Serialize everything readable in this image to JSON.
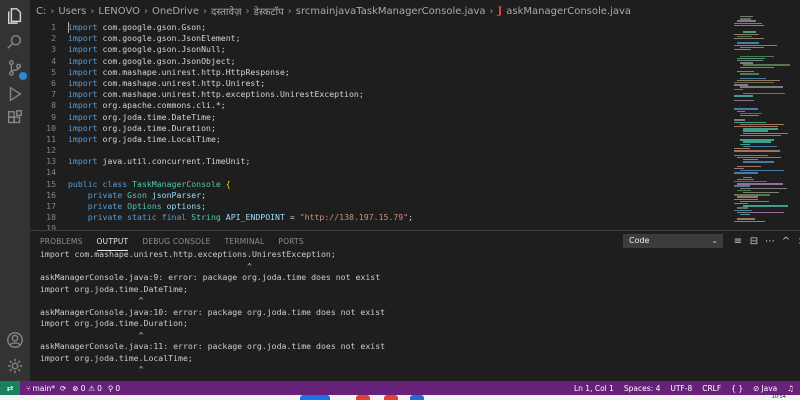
{
  "breadcrumb": {
    "segments": [
      "C:",
      "Users",
      "LENOVO",
      "OneDrive",
      "दस्तावेज़",
      "डेस्कटॉप",
      "srcmainjavaTaskManagerConsole.java"
    ],
    "file_icon": "J",
    "file": "askManagerConsole.java"
  },
  "activity_bar": [
    "files-icon",
    "search-icon",
    "source-control-icon",
    "run-debug-icon",
    "extensions-icon",
    "account-icon",
    "settings-gear-icon"
  ],
  "editor": {
    "lines": [
      {
        "n": "1",
        "tokens": [
          [
            "kw",
            "import"
          ],
          [
            "pl",
            " com.google.gson.Gson;"
          ]
        ]
      },
      {
        "n": "2",
        "tokens": [
          [
            "kw",
            "import"
          ],
          [
            "pl",
            " com.google.gson.JsonElement;"
          ]
        ]
      },
      {
        "n": "3",
        "tokens": [
          [
            "kw",
            "import"
          ],
          [
            "pl",
            " com.google.gson.JsonNull;"
          ]
        ]
      },
      {
        "n": "4",
        "tokens": [
          [
            "kw",
            "import"
          ],
          [
            "pl",
            " com.google.gson.JsonObject;"
          ]
        ]
      },
      {
        "n": "5",
        "tokens": [
          [
            "kw",
            "import"
          ],
          [
            "pl",
            " com.mashape.unirest.http.HttpResponse;"
          ]
        ]
      },
      {
        "n": "6",
        "tokens": [
          [
            "kw",
            "import"
          ],
          [
            "pl",
            " com.mashape.unirest.http.Unirest;"
          ]
        ]
      },
      {
        "n": "7",
        "tokens": [
          [
            "kw",
            "import"
          ],
          [
            "pl",
            " com.mashape.unirest.http.exceptions.UnirestException;"
          ]
        ]
      },
      {
        "n": "8",
        "tokens": [
          [
            "kw",
            "import"
          ],
          [
            "pl",
            " org.apache.commons.cli.*;"
          ]
        ]
      },
      {
        "n": "9",
        "tokens": [
          [
            "kw",
            "import"
          ],
          [
            "pl",
            " org.joda.time.DateTime;"
          ]
        ]
      },
      {
        "n": "10",
        "tokens": [
          [
            "kw",
            "import"
          ],
          [
            "pl",
            " org.joda.time.Duration;"
          ]
        ]
      },
      {
        "n": "11",
        "tokens": [
          [
            "kw",
            "import"
          ],
          [
            "pl",
            " org.joda.time.LocalTime;"
          ]
        ]
      },
      {
        "n": "12",
        "tokens": []
      },
      {
        "n": "13",
        "tokens": [
          [
            "kw",
            "import"
          ],
          [
            "pl",
            " java.util.concurrent.TimeUnit;"
          ]
        ]
      },
      {
        "n": "14",
        "tokens": []
      },
      {
        "n": "15",
        "tokens": [
          [
            "kw",
            "public class"
          ],
          [
            "pl",
            " "
          ],
          [
            "ty",
            "TaskManagerConsole"
          ],
          [
            "pl",
            " "
          ],
          [
            "br",
            "{"
          ]
        ]
      },
      {
        "n": "16",
        "tokens": [
          [
            "pl",
            "    "
          ],
          [
            "kw",
            "private"
          ],
          [
            "pl",
            " "
          ],
          [
            "ty",
            "Gson"
          ],
          [
            "pl",
            " "
          ],
          [
            "var",
            "jsonParser"
          ],
          [
            "pl",
            ";"
          ]
        ]
      },
      {
        "n": "17",
        "tokens": [
          [
            "pl",
            "    "
          ],
          [
            "kw",
            "private"
          ],
          [
            "pl",
            " "
          ],
          [
            "ty",
            "Options"
          ],
          [
            "pl",
            " "
          ],
          [
            "var",
            "options"
          ],
          [
            "pl",
            ";"
          ]
        ]
      },
      {
        "n": "18",
        "tokens": [
          [
            "pl",
            "    "
          ],
          [
            "kw",
            "private static final"
          ],
          [
            "pl",
            " "
          ],
          [
            "ty",
            "String"
          ],
          [
            "pl",
            " "
          ],
          [
            "var",
            "API_ENDPOINT"
          ],
          [
            "pl",
            " = "
          ],
          [
            "str",
            "\"http://138.197.15.79\""
          ],
          [
            "pl",
            ";"
          ]
        ]
      },
      {
        "n": "19",
        "tokens": []
      }
    ]
  },
  "panel": {
    "tabs": [
      "PROBLEMS",
      "OUTPUT",
      "DEBUG CONSOLE",
      "TERMINAL",
      "PORTS"
    ],
    "active_tab": "OUTPUT",
    "channel": "Code",
    "output_lines": [
      "import com.mashape.unirest.http.exceptions.UnirestException;",
      "                                          ^",
      "askManagerConsole.java:9: error: package org.joda.time does not exist",
      "import org.joda.time.DateTime;",
      "                    ^",
      "askManagerConsole.java:10: error: package org.joda.time does not exist",
      "import org.joda.time.Duration;",
      "                    ^",
      "askManagerConsole.java:11: error: package org.joda.time does not exist",
      "import org.joda.time.LocalTime;",
      "                    ^"
    ]
  },
  "status": {
    "branch": "main*",
    "errors": "0",
    "warnings": "0",
    "ports": "0",
    "position": "Ln 1, Col 1",
    "spaces": "Spaces: 4",
    "encoding": "UTF-8",
    "eol": "CRLF",
    "language_mode": "{ }",
    "language": "Java"
  },
  "taskbar": {
    "clock": "10:54"
  }
}
